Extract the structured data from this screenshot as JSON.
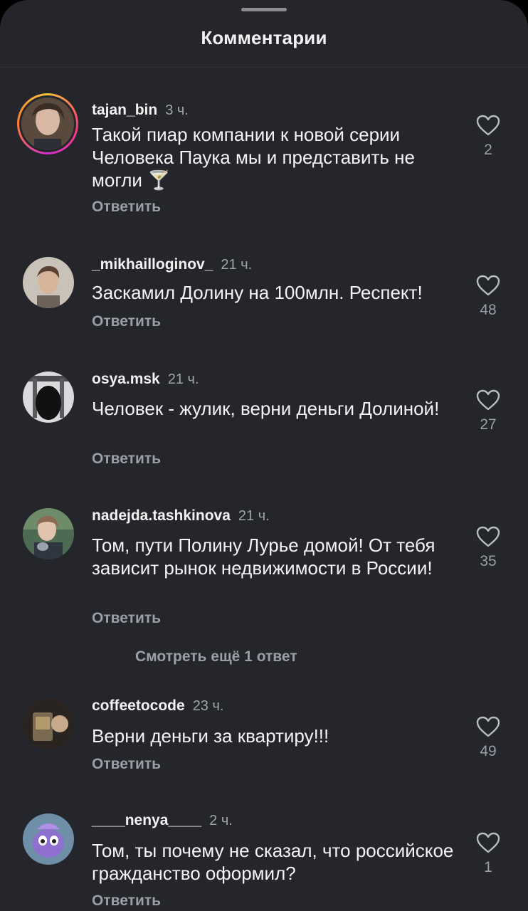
{
  "sheet": {
    "title": "Комментарии"
  },
  "reply_label": "Ответить",
  "more_replies": "Смотреть ещё 1 ответ",
  "comments": [
    {
      "user": "tajan_bin",
      "time": "3 ч.",
      "text": "Такой пиар компании к новой серии Человека Паука мы и представить не могли 🍸",
      "likes": "2",
      "avatar": "photo-with-story-ring"
    },
    {
      "user": "_mikhailloginov_",
      "time": "21 ч.",
      "text": "Заскамил Долину на 100млн. Респект!",
      "likes": "48",
      "avatar": "photo"
    },
    {
      "user": "osya.msk",
      "time": "21 ч.",
      "text": "Человек - жулик, верни деньги Долиной!",
      "likes": "27",
      "avatar": "photo"
    },
    {
      "user": "nadejda.tashkinova",
      "time": "21 ч.",
      "text": "Том, пути Полину Лурье домой! От тебя зависит рынок недвижимости в России!",
      "likes": "35",
      "avatar": "photo"
    },
    {
      "user": "coffeetocode",
      "time": "23 ч.",
      "text": "Верни деньги за квартиру!!!",
      "likes": "49",
      "avatar": "photo"
    },
    {
      "user": "____nenya____",
      "time": "2 ч.",
      "text": "Том, ты почему не сказал, что российское гражданство оформил?",
      "likes": "1",
      "avatar": "cartoon"
    }
  ],
  "icons": {
    "like": "heart-outline-icon"
  },
  "colors": {
    "background": "#24262b",
    "text": "#f4f4f4",
    "muted": "#9b9ea4"
  }
}
